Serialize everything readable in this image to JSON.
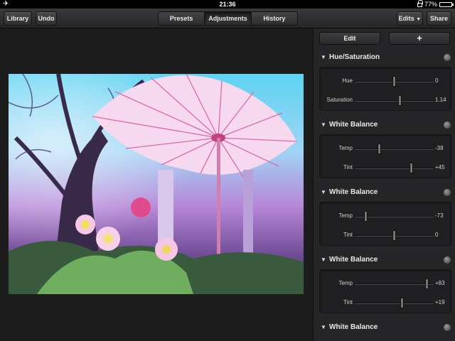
{
  "status": {
    "time": "21:36",
    "battery": "77%",
    "battery_level": 0.77
  },
  "toolbar": {
    "library": "Library",
    "undo": "Undo",
    "tabs": [
      {
        "label": "Presets",
        "active": false
      },
      {
        "label": "Adjustments",
        "active": true
      },
      {
        "label": "History",
        "active": false
      }
    ],
    "edits": "Edits",
    "share": "Share"
  },
  "panel": {
    "edit_label": "Edit",
    "add_label": "+",
    "sections": [
      {
        "title": "Hue/Saturation",
        "rows": [
          {
            "label": "Hue",
            "value": "0",
            "pos": 0.5
          },
          {
            "label": "Saturation",
            "value": "1.14",
            "pos": 0.57
          }
        ]
      },
      {
        "title": "White Balance",
        "rows": [
          {
            "label": "Temp",
            "value": "-38",
            "pos": 0.31
          },
          {
            "label": "Tint",
            "value": "+45",
            "pos": 0.72
          }
        ]
      },
      {
        "title": "White Balance",
        "rows": [
          {
            "label": "Temp",
            "value": "-73",
            "pos": 0.14
          },
          {
            "label": "Tint",
            "value": "0",
            "pos": 0.5
          }
        ]
      },
      {
        "title": "White Balance",
        "rows": [
          {
            "label": "Temp",
            "value": "+83",
            "pos": 0.92
          },
          {
            "label": "Tint",
            "value": "+19",
            "pos": 0.6
          }
        ]
      },
      {
        "title": "White Balance",
        "rows": []
      }
    ]
  }
}
